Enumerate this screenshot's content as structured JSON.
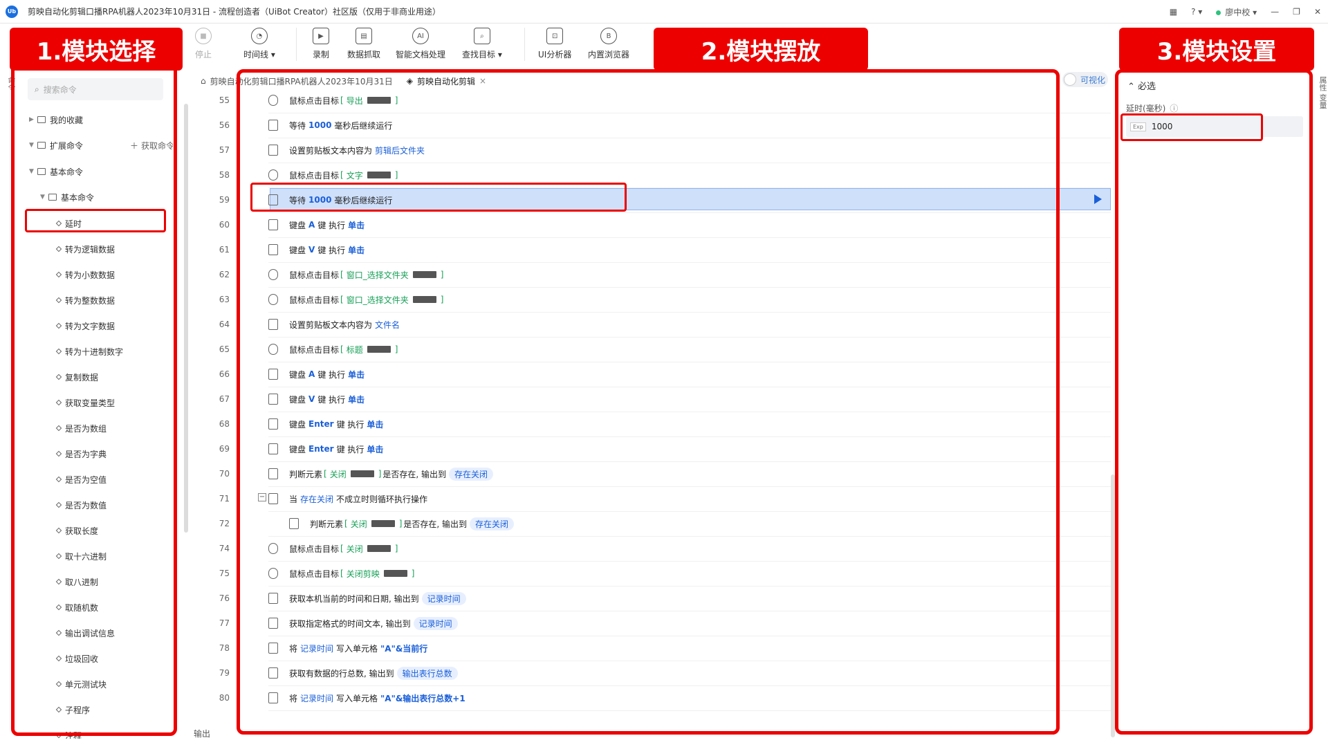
{
  "window": {
    "title": "剪映自动化剪辑口播RPA机器人2023年10月31日 - 流程创造者（UiBot Creator）社区版（仅用于非商业用途）",
    "logo": "Ub",
    "user": "廖中校"
  },
  "toolbar": [
    {
      "label": "停止",
      "icon": "stop-icon",
      "disabled": true
    },
    {
      "label": "时间线 ▾",
      "icon": "clock-icon"
    },
    {
      "label": "录制",
      "icon": "record-icon"
    },
    {
      "label": "数据抓取",
      "icon": "data-grab-icon"
    },
    {
      "label": "智能文档处理",
      "icon": "ai-doc-icon"
    },
    {
      "label": "查找目标 ▾",
      "icon": "find-target-icon"
    },
    {
      "label": "UI分析器",
      "icon": "ui-analyzer-icon"
    },
    {
      "label": "内置浏览器",
      "icon": "browser-icon"
    }
  ],
  "annotations": {
    "label1": "1.模块选择",
    "label2": "2.模块摆放",
    "label3": "3.模块设置"
  },
  "left": {
    "search_placeholder": "搜索命令",
    "favorites": "我的收藏",
    "extensions": "扩展命令",
    "get_commands": "获取命令",
    "basic": "基本命令",
    "basic_sub": "基本命令",
    "items": [
      "延时",
      "转为逻辑数据",
      "转为小数数据",
      "转为整数数据",
      "转为文字数据",
      "转为十进制数字",
      "复制数据",
      "获取变量类型",
      "是否为数组",
      "是否为字典",
      "是否为空值",
      "是否为数值",
      "获取长度",
      "取十六进制",
      "取八进制",
      "取随机数",
      "输出调试信息",
      "垃圾回收",
      "单元测试块",
      "子程序",
      "注释"
    ]
  },
  "tabs": [
    {
      "label": "剪映自动化剪辑口播RPA机器人2023年10月31日"
    },
    {
      "label": "剪映自动化剪辑"
    }
  ],
  "visual_toggle": "可视化",
  "bottom": {
    "output": "输出"
  },
  "side_tabs": {
    "left": "命令",
    "right": "属性 变量"
  },
  "props": {
    "section": "必选",
    "delay_label": "延时(毫秒)",
    "exp_tag": "Exp",
    "delay_value": "1000"
  },
  "lines": [
    {
      "n": "55",
      "t": "click",
      "a": "导出"
    },
    {
      "n": "56",
      "t": "wait",
      "v": "1000"
    },
    {
      "n": "57",
      "t": "clip",
      "v": "剪辑后文件夹"
    },
    {
      "n": "58",
      "t": "click",
      "a": "文字"
    },
    {
      "n": "59",
      "t": "wait",
      "v": "1000"
    },
    {
      "n": "60",
      "t": "key",
      "k": "A"
    },
    {
      "n": "61",
      "t": "key",
      "k": "V"
    },
    {
      "n": "62",
      "t": "click",
      "a": "窗口_选择文件夹"
    },
    {
      "n": "63",
      "t": "click",
      "a": "窗口_选择文件夹"
    },
    {
      "n": "64",
      "t": "clip",
      "v": "文件名"
    },
    {
      "n": "65",
      "t": "click",
      "a": "标题"
    },
    {
      "n": "66",
      "t": "key",
      "k": "A"
    },
    {
      "n": "67",
      "t": "key",
      "k": "V"
    },
    {
      "n": "68",
      "t": "key",
      "k": "Enter"
    },
    {
      "n": "69",
      "t": "key",
      "k": "Enter"
    },
    {
      "n": "70",
      "t": "exists",
      "a": "关闭",
      "o": "存在关闭"
    },
    {
      "n": "71",
      "t": "loop",
      "v": "存在关闭"
    },
    {
      "n": "72",
      "t": "exists",
      "a": "关闭",
      "o": "存在关闭"
    },
    {
      "n": "74",
      "t": "click",
      "a": "关闭"
    },
    {
      "n": "75",
      "t": "click",
      "a": "关闭剪映"
    },
    {
      "n": "76",
      "t": "time",
      "o": "记录时间"
    },
    {
      "n": "77",
      "t": "fmt",
      "o": "记录时间"
    },
    {
      "n": "78",
      "t": "write",
      "v": "记录时间",
      "c": "\"A\"&当前行"
    },
    {
      "n": "79",
      "t": "rows",
      "o": "输出表行总数"
    },
    {
      "n": "80",
      "t": "write",
      "v": "记录时间",
      "c": "\"A\"&输出表行总数+1"
    }
  ],
  "text": {
    "click": "鼠标点击目标",
    "wait_pre": "等待",
    "wait_post": "毫秒后继续运行",
    "clip": "设置剪贴板文本内容为",
    "key_pre": "键盘",
    "key_mid": "键 执行",
    "key_act": "单击",
    "exists_pre": "判断元素",
    "exists_mid": "是否存在, 输出到",
    "loop_pre": "当",
    "loop_post": "不成立时则循环执行操作",
    "time": "获取本机当前的时间和日期, 输出到",
    "fmt": "获取指定格式的时间文本, 输出到",
    "write_pre": "将",
    "write_mid": "写入单元格",
    "rows": "获取有数据的行总数, 输出到"
  }
}
